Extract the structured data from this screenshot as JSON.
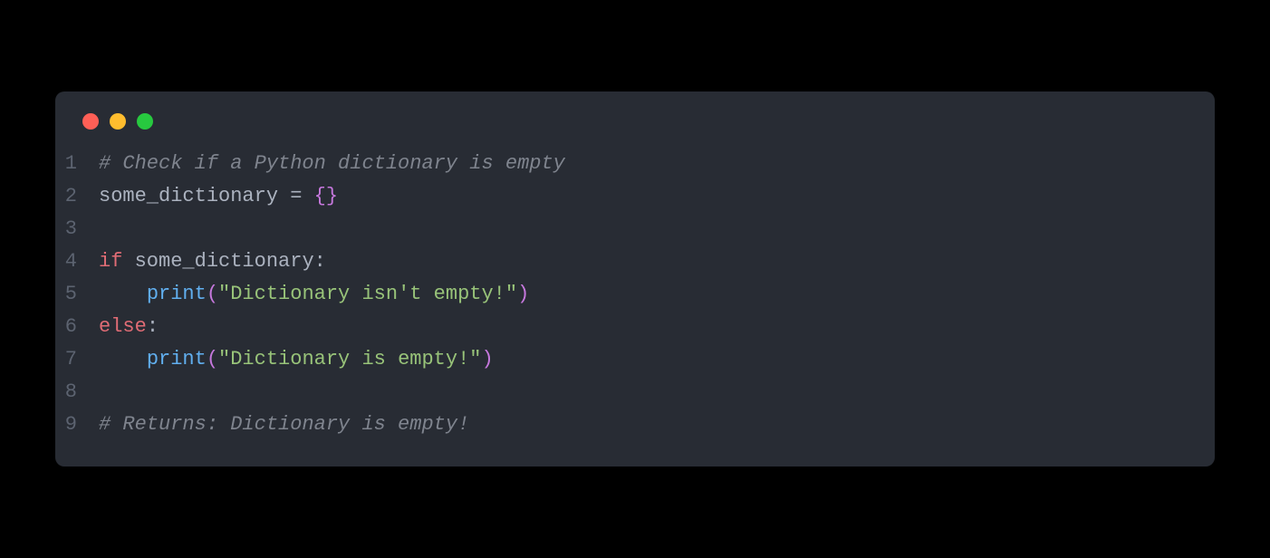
{
  "code": {
    "lines": [
      {
        "num": "1",
        "tokens": [
          {
            "cls": "tok-comment",
            "text": "# Check if a Python dictionary is empty"
          }
        ]
      },
      {
        "num": "2",
        "tokens": [
          {
            "cls": "tok-default",
            "text": "some_dictionary "
          },
          {
            "cls": "tok-operator",
            "text": "="
          },
          {
            "cls": "tok-default",
            "text": " "
          },
          {
            "cls": "tok-brace",
            "text": "{}"
          }
        ]
      },
      {
        "num": "3",
        "tokens": []
      },
      {
        "num": "4",
        "tokens": [
          {
            "cls": "tok-keyword",
            "text": "if"
          },
          {
            "cls": "tok-default",
            "text": " some_dictionary"
          },
          {
            "cls": "tok-punctuation",
            "text": ":"
          }
        ]
      },
      {
        "num": "5",
        "tokens": [
          {
            "cls": "tok-default",
            "text": "    "
          },
          {
            "cls": "tok-function",
            "text": "print"
          },
          {
            "cls": "tok-brace",
            "text": "("
          },
          {
            "cls": "tok-string",
            "text": "\"Dictionary isn't empty!\""
          },
          {
            "cls": "tok-brace",
            "text": ")"
          }
        ]
      },
      {
        "num": "6",
        "tokens": [
          {
            "cls": "tok-keyword",
            "text": "else"
          },
          {
            "cls": "tok-punctuation",
            "text": ":"
          }
        ]
      },
      {
        "num": "7",
        "tokens": [
          {
            "cls": "tok-default",
            "text": "    "
          },
          {
            "cls": "tok-function",
            "text": "print"
          },
          {
            "cls": "tok-brace",
            "text": "("
          },
          {
            "cls": "tok-string",
            "text": "\"Dictionary is empty!\""
          },
          {
            "cls": "tok-brace",
            "text": ")"
          }
        ]
      },
      {
        "num": "8",
        "tokens": []
      },
      {
        "num": "9",
        "tokens": [
          {
            "cls": "tok-comment",
            "text": "# Returns: Dictionary is empty!"
          }
        ]
      }
    ]
  },
  "colors": {
    "background": "#282c34",
    "comment": "#7f848e",
    "default": "#abb2bf",
    "keyword": "#e06c75",
    "function": "#61afef",
    "string": "#98c379",
    "brace": "#c678dd",
    "lineNumber": "#5c6370"
  }
}
